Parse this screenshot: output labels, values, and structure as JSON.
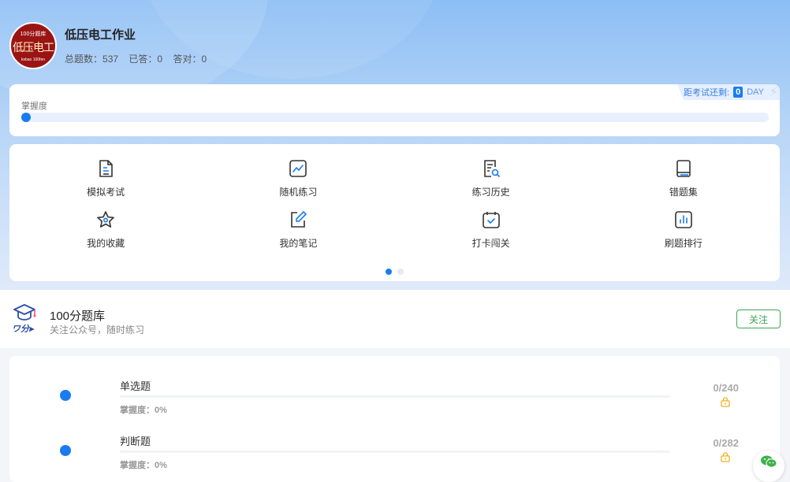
{
  "header": {
    "avatar": {
      "top_text": "100分题库",
      "main_text": "低压电工",
      "bottom_text": "ksbao 100fen"
    },
    "title": "低压电工作业",
    "stats": {
      "total_label": "总题数：",
      "total": "537",
      "answered_label": "已答：",
      "answered": "0",
      "correct_label": "答对：",
      "correct": "0"
    }
  },
  "mastery": {
    "label": "掌握度",
    "countdown_label": "距考试还剩:",
    "countdown_days": "0",
    "countdown_unit": "DAY",
    "progress": 0
  },
  "menu": {
    "items": [
      {
        "label": "模拟考试",
        "icon": "document-icon"
      },
      {
        "label": "随机练习",
        "icon": "chart-line-icon"
      },
      {
        "label": "练习历史",
        "icon": "history-search-icon"
      },
      {
        "label": "错题集",
        "icon": "book-icon"
      },
      {
        "label": "我的收藏",
        "icon": "star-icon"
      },
      {
        "label": "我的笔记",
        "icon": "edit-note-icon"
      },
      {
        "label": "打卡闯关",
        "icon": "calendar-check-icon"
      },
      {
        "label": "刷题排行",
        "icon": "bar-chart-icon"
      }
    ],
    "page_count": 2,
    "active_page": 0
  },
  "follow": {
    "title": "100分题库",
    "subtitle": "关注公众号，随时练习",
    "button": "关注"
  },
  "questions": [
    {
      "name": "单选题",
      "mastery_label": "掌握度：",
      "mastery": "0%",
      "count": "0/240",
      "locked": true
    },
    {
      "name": "判断题",
      "mastery_label": "掌握度：",
      "mastery": "0%",
      "count": "0/282",
      "locked": true
    }
  ],
  "colors": {
    "accent": "#1a7cf0",
    "follow_green": "#3aa657",
    "lock_orange": "#f0b020"
  }
}
